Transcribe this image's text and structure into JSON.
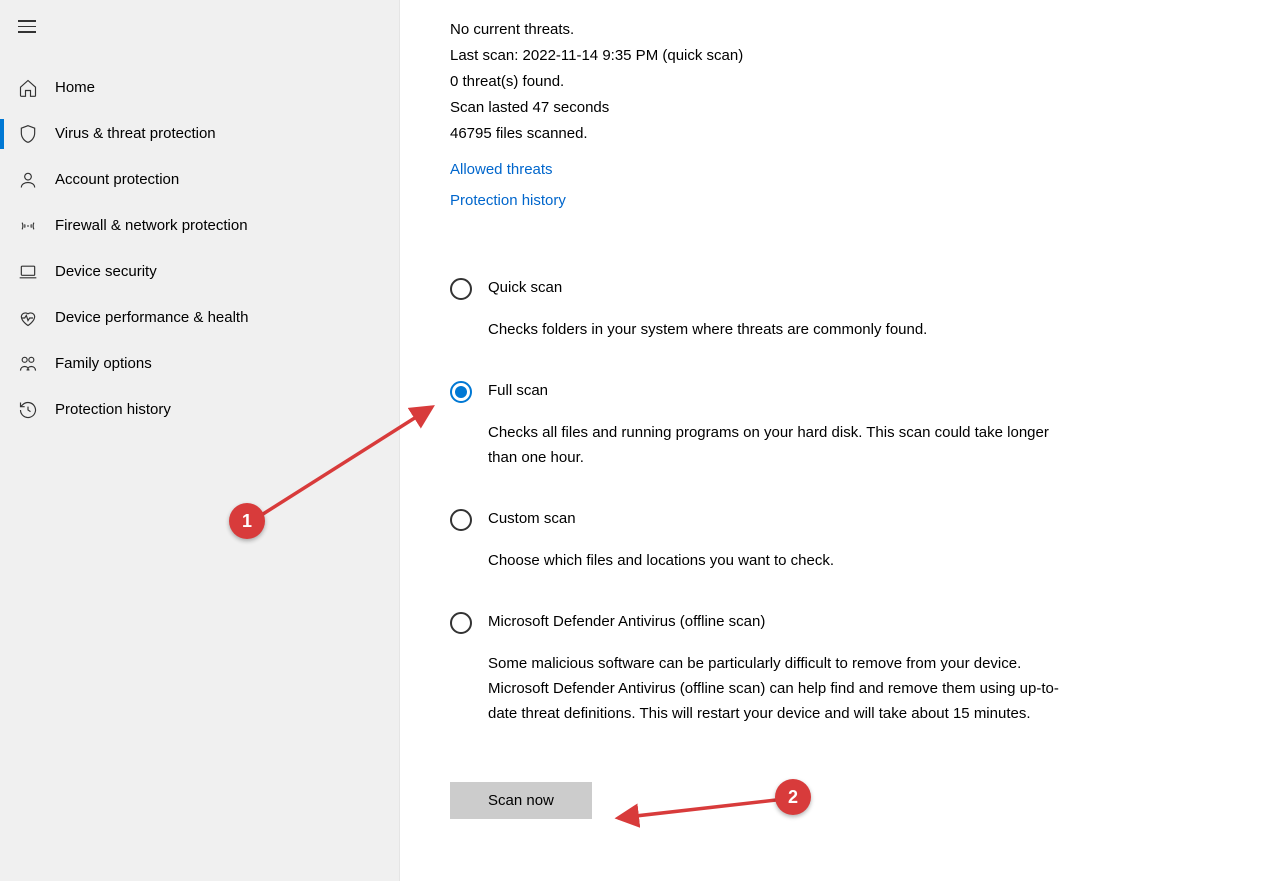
{
  "sidebar": {
    "items": [
      {
        "label": "Home"
      },
      {
        "label": "Virus & threat protection"
      },
      {
        "label": "Account protection"
      },
      {
        "label": "Firewall & network protection"
      },
      {
        "label": "Device security"
      },
      {
        "label": "Device performance & health"
      },
      {
        "label": "Family options"
      },
      {
        "label": "Protection history"
      }
    ]
  },
  "status": {
    "no_threats": "No current threats.",
    "last_scan": "Last scan: 2022-11-14 9:35 PM (quick scan)",
    "threats_found": "0 threat(s) found.",
    "scan_duration": "Scan lasted 47 seconds",
    "files_scanned": "46795 files scanned."
  },
  "links": {
    "allowed_threats": "Allowed threats",
    "protection_history": "Protection history"
  },
  "scan_options": [
    {
      "title": "Quick scan",
      "desc": "Checks folders in your system where threats are commonly found."
    },
    {
      "title": "Full scan",
      "desc": "Checks all files and running programs on your hard disk. This scan could take longer than one hour."
    },
    {
      "title": "Custom scan",
      "desc": "Choose which files and locations you want to check."
    },
    {
      "title": "Microsoft Defender Antivirus (offline scan)",
      "desc": "Some malicious software can be particularly difficult to remove from your device. Microsoft Defender Antivirus (offline scan) can help find and remove them using up-to-date threat definitions. This will restart your device and will take about 15 minutes."
    }
  ],
  "buttons": {
    "scan_now": "Scan now"
  },
  "annotations": {
    "badge1": "1",
    "badge2": "2"
  }
}
